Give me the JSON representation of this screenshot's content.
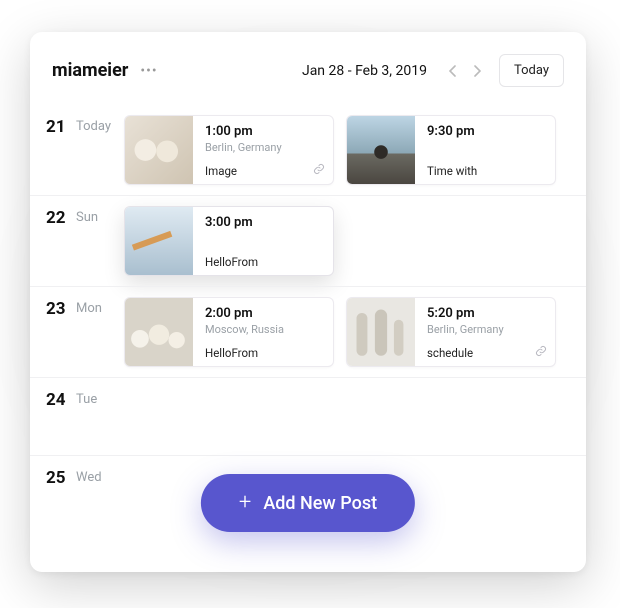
{
  "header": {
    "account": "miameier",
    "date_range": "Jan 28 - Feb 3, 2019",
    "today_label": "Today"
  },
  "add_button": {
    "label": "Add New Post"
  },
  "days": [
    {
      "num": "21",
      "name": "Today",
      "posts": [
        {
          "time": "1:00 pm",
          "location": "Berlin, Germany",
          "title": "Image",
          "thumb": "a",
          "link": true
        },
        {
          "time": "9:30 pm",
          "location": "",
          "title": "Time with",
          "thumb": "b",
          "link": false
        }
      ]
    },
    {
      "num": "22",
      "name": "Sun",
      "posts": [
        {
          "time": "3:00 pm",
          "location": "",
          "title": "HelloFrom",
          "thumb": "c",
          "link": false,
          "elevated": true
        }
      ]
    },
    {
      "num": "23",
      "name": "Mon",
      "posts": [
        {
          "time": "2:00 pm",
          "location": "Moscow, Russia",
          "title": "HelloFrom",
          "thumb": "d",
          "link": false
        },
        {
          "time": "5:20 pm",
          "location": "Berlin, Germany",
          "title": "schedule",
          "thumb": "e",
          "link": true
        }
      ]
    },
    {
      "num": "24",
      "name": "Tue",
      "posts": []
    },
    {
      "num": "25",
      "name": "Wed",
      "posts": []
    }
  ]
}
